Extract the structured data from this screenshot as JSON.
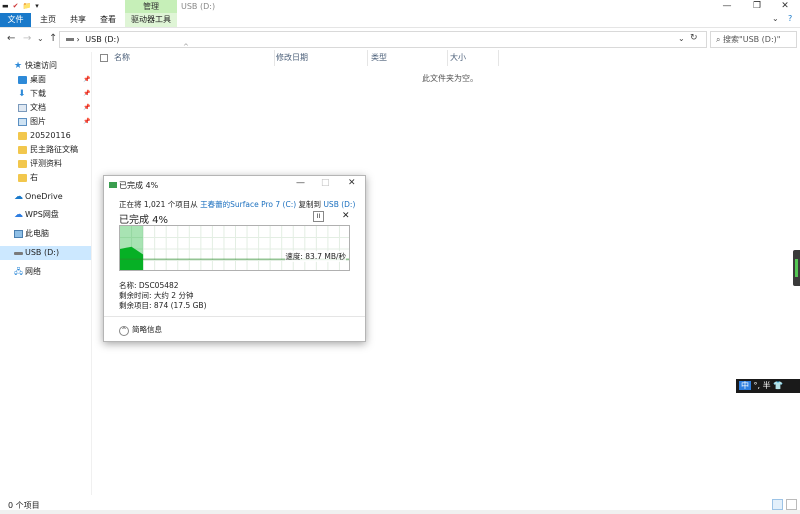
{
  "window": {
    "quick_access": [
      "▬",
      "✔",
      "📁",
      "▾"
    ],
    "manage_tab": "管理",
    "title": "USB (D:)",
    "minimize": "—",
    "maximize": "❐",
    "close": "✕"
  },
  "ribbon": {
    "tabs": [
      "文件",
      "主页",
      "共享",
      "查看",
      "驱动器工具"
    ],
    "collapse": "⌄",
    "help": "?"
  },
  "address_bar": {
    "back": "←",
    "forward": "→",
    "recent": "⌄",
    "up": "↑",
    "path_prefix": "›",
    "path": "USB (D:)",
    "dropdown": "⌄",
    "refresh": "↻",
    "search_placeholder": "搜索\"USB (D:)\""
  },
  "nav_pane": {
    "quick_access": "快速访问",
    "pinned": [
      {
        "label": "桌面",
        "icon": "desktop-icon"
      },
      {
        "label": "下载",
        "icon": "download-icon"
      },
      {
        "label": "文档",
        "icon": "document-icon"
      },
      {
        "label": "图片",
        "icon": "picture-icon"
      }
    ],
    "folders": [
      "20520116",
      "民主路征文稿",
      "评测资料",
      "右"
    ],
    "onedrive": "OneDrive",
    "wps": "WPS网盘",
    "this_pc": "此电脑",
    "usb": "USB (D:)",
    "network": "网络"
  },
  "columns": {
    "name": "名称",
    "modified": "修改日期",
    "type": "类型",
    "size": "大小"
  },
  "empty_message": "此文件夹为空。",
  "status": {
    "item_count": "0 个项目"
  },
  "copy_dialog": {
    "title": "已完成 4%",
    "line_prefix": "正在将 1,021 个项目从",
    "source": "王春蕾的Surface Pro 7 (C:)",
    "line_mid": "复制到",
    "dest": "USB (D:)",
    "percent_heading": "已完成 4%",
    "pause": "II",
    "cancel": "✕",
    "speed": "速度: 83.7 MB/秒",
    "name_label": "名称: DSC05482",
    "remaining_time": "剩余时间: 大约 2 分钟",
    "remaining_items": "剩余项目: 874 (17.5 GB)",
    "less_details": "简略信息",
    "progress": 0.04
  },
  "ime": {
    "mode": "中",
    "text": "°, 半 👕"
  },
  "colors": {
    "accent": "#1979ca",
    "manage_tab": "#c6efb8",
    "graph_fill": "#06b025",
    "selection": "#cce8ff"
  }
}
